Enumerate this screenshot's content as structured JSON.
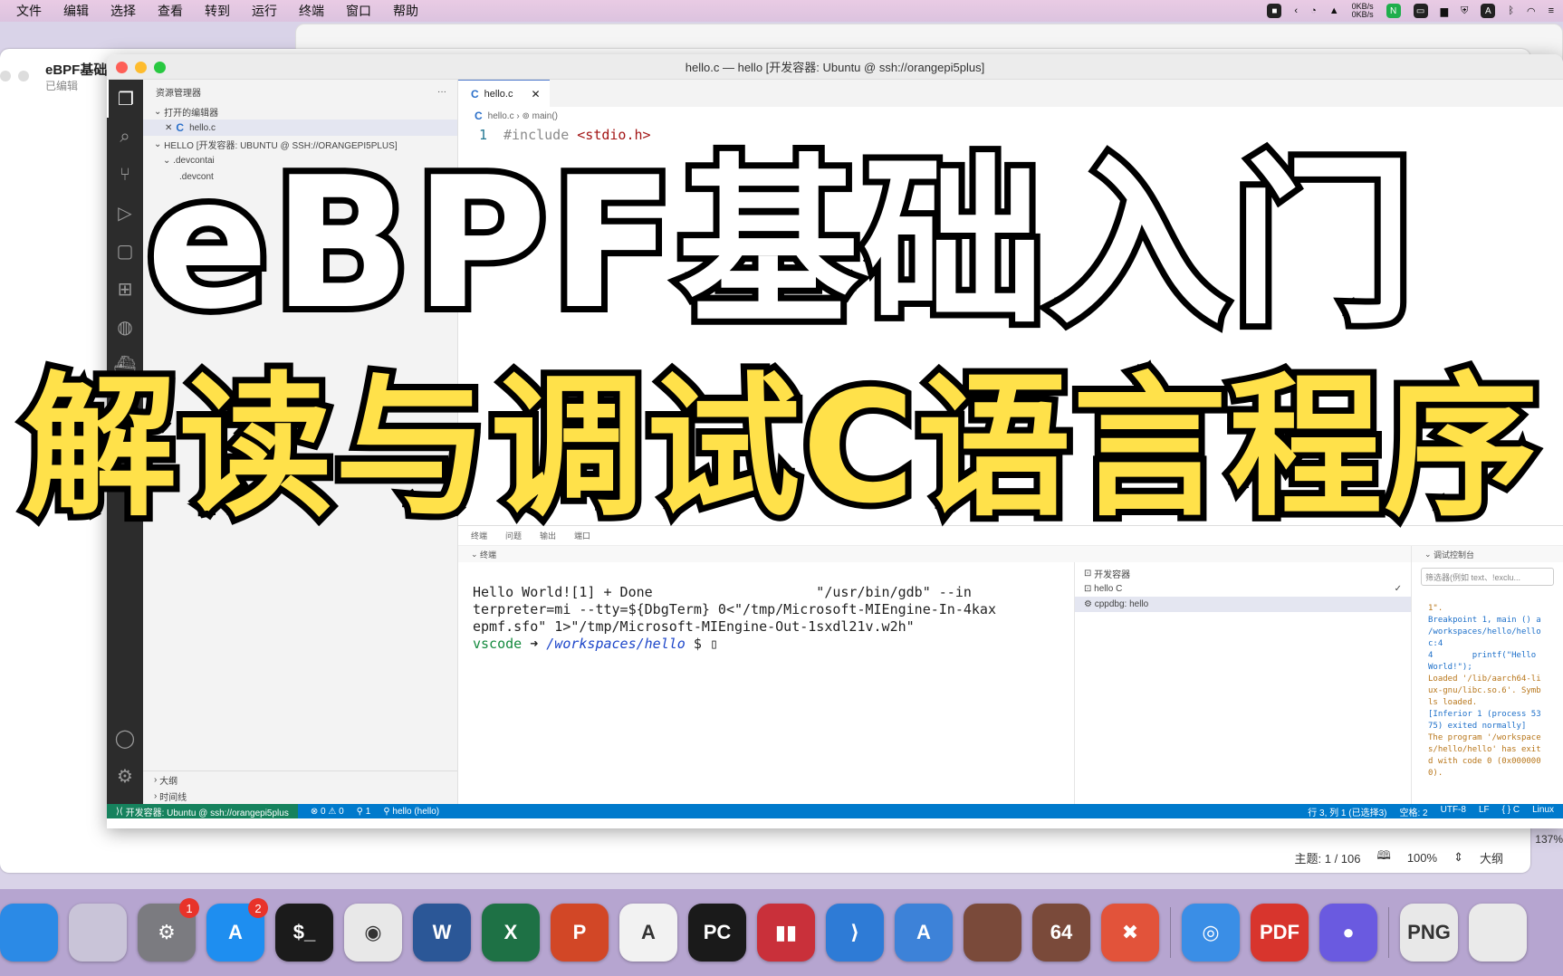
{
  "menubar": {
    "items": [
      "文件",
      "编辑",
      "选择",
      "查看",
      "转到",
      "运行",
      "终端",
      "窗口",
      "帮助"
    ],
    "net_up": "0KB/s",
    "net_down": "0KB/s"
  },
  "bg_window": {
    "title": "eBPF基础",
    "subtitle": "已编辑",
    "footer_page": "主题: 1 / 106",
    "footer_zoom": "100%",
    "footer_outline": "大纲",
    "side_zoom": "137%"
  },
  "vscode": {
    "title": "hello.c — hello [开发容器: Ubuntu @ ssh://orangepi5plus]",
    "sidebar": {
      "header": "资源管理器",
      "open_editors": "打开的编辑器",
      "open_file": "hello.c",
      "workspace": "HELLO [开发容器: UBUNTU @ SSH://ORANGEPI5PLUS]",
      "folder": ".devcontai",
      "sub": ".devcont",
      "outline": "大纲",
      "timeline": "时间线"
    },
    "editor": {
      "tab": "hello.c",
      "breadcrumb_file": "hello.c",
      "breadcrumb_fn": "main()",
      "line1_num": "1",
      "line1_kw": "#include",
      "line1_hdr": "<stdio.h>"
    },
    "panel": {
      "tabs": [
        "终端",
        "问题",
        "输出",
        "端口"
      ],
      "sub": "终端",
      "terminal_line1": "Hello World![1] + Done                    \"/usr/bin/gdb\" --in",
      "terminal_line2": "terpreter=mi --tty=${DbgTerm} 0<\"/tmp/Microsoft-MIEngine-In-4kax",
      "terminal_line3": "epmf.sfo\" 1>\"/tmp/Microsoft-MIEngine-Out-1sxdl21v.w2h\"",
      "prompt_user": "vscode",
      "prompt_arrow": "➜",
      "prompt_path": "/workspaces/hello",
      "prompt_sign": "$",
      "term_list": [
        "开发容器",
        "hello C",
        "cppdbg: hello"
      ]
    },
    "debug": {
      "header": "调试控制台",
      "filter_placeholder": "筛选器(例如 text、!exclu...",
      "out_lines": [
        "1\".",
        "",
        "Breakpoint 1, main () a",
        "/workspaces/hello/hello",
        "c:4",
        "4        printf(\"Hello",
        "World!\");",
        "Loaded '/lib/aarch64-li",
        "ux-gnu/libc.so.6'. Symb",
        "ls loaded.",
        "[Inferior 1 (process 53",
        "75) exited normally]",
        "The program '/workspace",
        "s/hello/hello' has exit",
        "d with code 0 (0x000000",
        "0)."
      ]
    },
    "statusbar": {
      "remote": "开发容器: Ubuntu @ ssh://orangepi5plus",
      "problems": "⊗ 0 ⚠ 0",
      "ports": "⚲ 1",
      "debug": "hello (hello)",
      "position": "行 3, 列 1 (已选择3)",
      "spaces": "空格: 2",
      "encoding": "UTF-8",
      "eol": "LF",
      "lang": "{ } C",
      "os": "Linux"
    }
  },
  "overlay": {
    "line1": "eBPF基础入门",
    "line2": "解读与调试C语言程序"
  },
  "dock": {
    "items": [
      {
        "name": "finder",
        "label": "",
        "color": "#2b8ae6"
      },
      {
        "name": "launchpad",
        "label": "",
        "color": "#c9c4d8"
      },
      {
        "name": "system-settings",
        "label": "⚙",
        "color": "#7b7b80",
        "badge": "1"
      },
      {
        "name": "app-store",
        "label": "A",
        "color": "#1e8ef0",
        "badge": "2"
      },
      {
        "name": "terminal",
        "label": "$_",
        "color": "#1b1b1b"
      },
      {
        "name": "chrome",
        "label": "◉",
        "color": "#e8e8e8"
      },
      {
        "name": "word",
        "label": "W",
        "color": "#2b5797"
      },
      {
        "name": "excel",
        "label": "X",
        "color": "#1e7145"
      },
      {
        "name": "powerpoint",
        "label": "P",
        "color": "#d24726"
      },
      {
        "name": "instruments",
        "label": "A",
        "color": "#f2f2f2"
      },
      {
        "name": "pycharm",
        "label": "PC",
        "color": "#1a1a1a"
      },
      {
        "name": "parallels",
        "label": "▮▮",
        "color": "#c9303a"
      },
      {
        "name": "vscode",
        "label": "⟩",
        "color": "#2e7bd6"
      },
      {
        "name": "xcode-app",
        "label": "A",
        "color": "#3d82d8"
      },
      {
        "name": "portrait-app",
        "label": "",
        "color": "#7a4a3a"
      },
      {
        "name": "portrait-app-64",
        "label": "64",
        "color": "#7a4a3a"
      },
      {
        "name": "xmind",
        "label": "✖",
        "color": "#e2533a"
      },
      {
        "name": "safari",
        "label": "◎",
        "color": "#3a8ee6"
      },
      {
        "name": "pdf-expert",
        "label": "PDF",
        "color": "#d8352d"
      },
      {
        "name": "siri",
        "label": "●",
        "color": "#6a5ae0"
      },
      {
        "name": "preview",
        "label": "PNG",
        "color": "#e8e8e8"
      },
      {
        "name": "trash",
        "label": "",
        "color": "#eaeaea"
      }
    ]
  }
}
